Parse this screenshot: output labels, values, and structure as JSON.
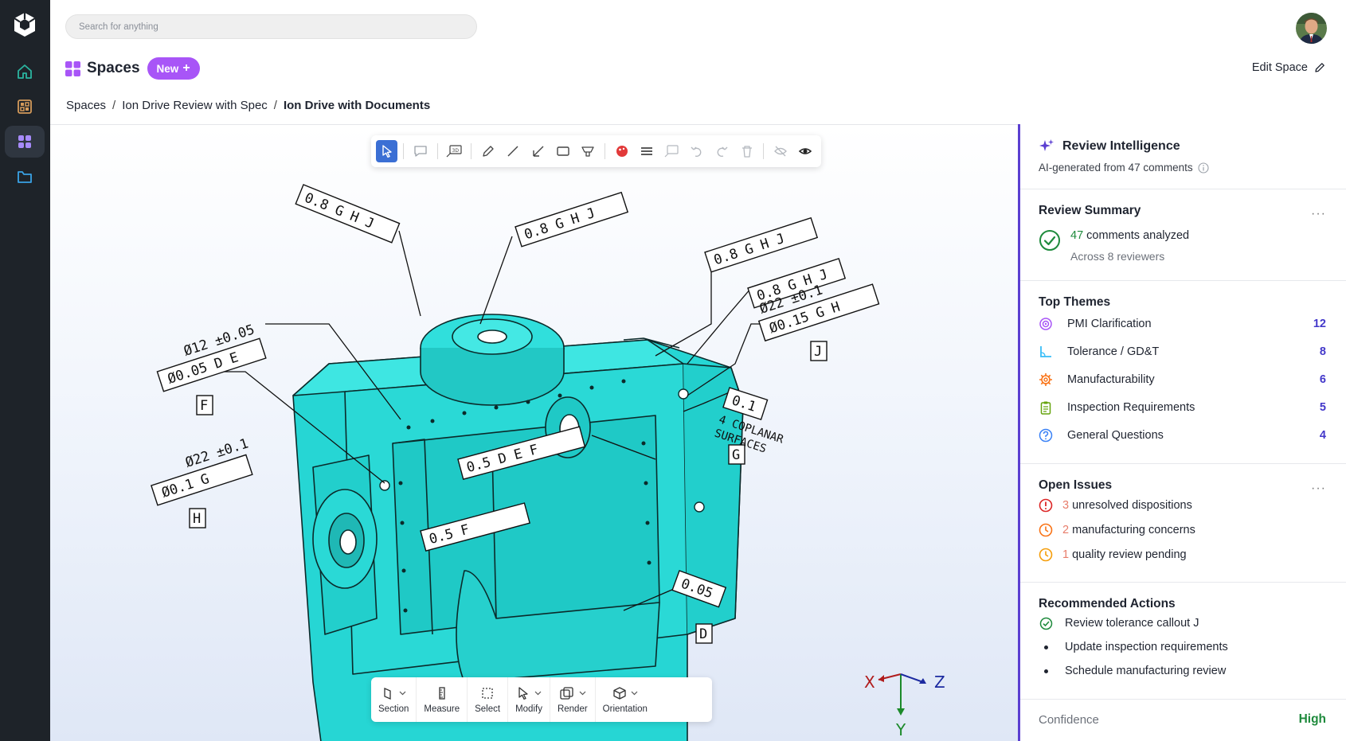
{
  "header": {
    "search_placeholder": "Search for anything",
    "spaces_title": "Spaces",
    "new_label": "New",
    "edit_space_label": "Edit Space"
  },
  "breadcrumb": [
    "Spaces",
    "Ion Drive Review with Spec",
    "Ion Drive with Documents"
  ],
  "toolbar_bottom": [
    {
      "label": "Section",
      "icon": "section-icon",
      "dropdown": true
    },
    {
      "label": "Measure",
      "icon": "ruler-icon",
      "dropdown": false
    },
    {
      "label": "Select",
      "icon": "select-box-icon",
      "dropdown": false
    },
    {
      "label": "Modify",
      "icon": "cursor-icon",
      "dropdown": true
    },
    {
      "label": "Render",
      "icon": "render-icon",
      "dropdown": true
    },
    {
      "label": "Orientation",
      "icon": "cube-icon",
      "dropdown": true
    }
  ],
  "axes": {
    "x": "X",
    "y": "Y",
    "z": "Z"
  },
  "annotations": {
    "a1": "0.8 G H J",
    "a2": "0.8 G H J",
    "a3": "0.8 G H J",
    "a4": "0.8 G H J",
    "dim1": "Ø12 ±0.05",
    "fcf1": "Ø0.05 D E",
    "datum_f": "F",
    "dim2": "Ø22 ±0.1",
    "fcf2": "Ø0.1 G",
    "datum_h": "H",
    "dim3": "Ø22 ±0.1",
    "fcf3": "Ø0.15 G H",
    "datum_j": "J",
    "flat1": "0.1",
    "coplanar": "4 COPLANAR",
    "surfaces": "SURFACES",
    "datum_g": "G",
    "mid1": "0.5 D E F",
    "mid2": "0.5 F",
    "flat2": "0.05",
    "datum_d": "D"
  },
  "panel": {
    "title": "Review Intelligence",
    "subtitle": "AI-generated from 47 comments",
    "summary": {
      "title": "Review Summary",
      "count": "47",
      "main_text": "comments analyzed",
      "sub_text": "Across 8 reviewers"
    },
    "themes": {
      "title": "Top Themes",
      "items": [
        {
          "label": "PMI Clarification",
          "count": "12",
          "icon": "target-icon",
          "color": "#a855f7"
        },
        {
          "label": "Tolerance / GD&T",
          "count": "8",
          "icon": "angle-icon",
          "color": "#38bdf8"
        },
        {
          "label": "Manufacturability",
          "count": "6",
          "icon": "gear-icon",
          "color": "#f97316"
        },
        {
          "label": "Inspection Requirements",
          "count": "5",
          "icon": "clipboard-icon",
          "color": "#65a30d"
        },
        {
          "label": "General Questions",
          "count": "4",
          "icon": "question-icon",
          "color": "#3b82f6"
        }
      ]
    },
    "issues": {
      "title": "Open Issues",
      "items": [
        {
          "count": "3",
          "label": "unresolved dispositions",
          "icon": "alert-icon",
          "color": "#dc2626"
        },
        {
          "count": "2",
          "label": "manufacturing concerns",
          "icon": "clock-icon",
          "color": "#f97316"
        },
        {
          "count": "1",
          "label": "quality review pending",
          "icon": "clock-icon",
          "color": "#f59e0b"
        }
      ]
    },
    "actions": {
      "title": "Recommended Actions",
      "items": [
        {
          "label": "Review tolerance callout J",
          "done": true
        },
        {
          "label": "Update inspection requirements",
          "done": false
        },
        {
          "label": "Schedule manufacturing review",
          "done": false
        }
      ]
    },
    "confidence": {
      "label": "Confidence",
      "value": "High"
    }
  }
}
